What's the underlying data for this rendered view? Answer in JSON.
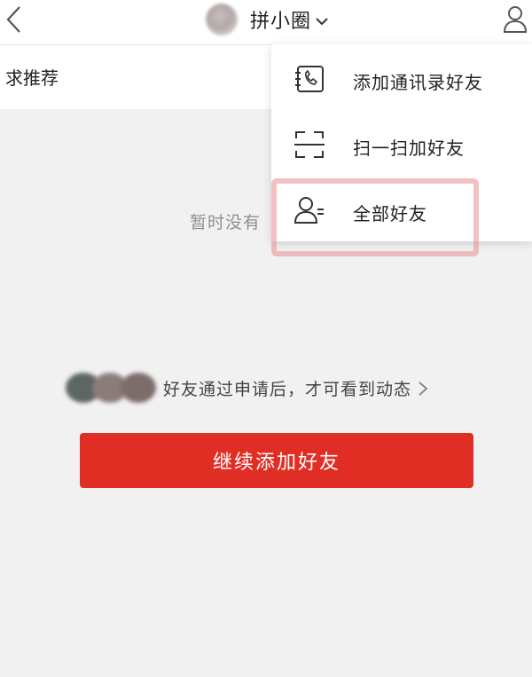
{
  "header": {
    "title": "拼小圈",
    "icons": {
      "back": "chevron-left-icon",
      "title_dropdown": "chevron-down-icon",
      "profile": "person-icon"
    }
  },
  "subbar": {
    "label": "求推荐"
  },
  "empty_state": {
    "text": "暂时没有"
  },
  "friends_info": {
    "text": "好友通过申请后，才可看到动态",
    "icon": "chevron-right-icon"
  },
  "cta": {
    "label": "继续添加好友"
  },
  "menu": {
    "items": [
      {
        "label": "添加通讯录好友",
        "icon": "contacts-phone-icon"
      },
      {
        "label": "扫一扫加好友",
        "icon": "scan-icon"
      },
      {
        "label": "全部好友",
        "icon": "friends-list-icon"
      }
    ],
    "highlighted_item": "全部好友"
  },
  "colors": {
    "accent": "#e02e24",
    "background": "#f1f1f1",
    "highlight": "#ea8c94"
  }
}
